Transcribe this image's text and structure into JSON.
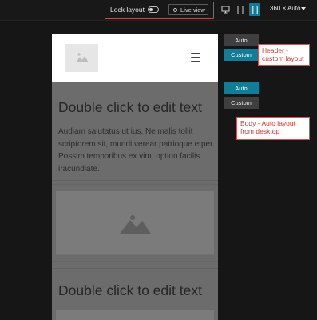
{
  "toolbar": {
    "lock_layout_label": "Lock layout",
    "lock_layout_on": false,
    "live_view_label": "Live view",
    "device_selected": "mobile",
    "size_label": "360 × Auto"
  },
  "header_layout": {
    "auto_label": "Auto",
    "custom_label": "Custom",
    "selected": "Custom"
  },
  "body_layout": {
    "auto_label": "Auto",
    "custom_label": "Custom",
    "selected": "Auto"
  },
  "page": {
    "heading1": "Double click to edit text",
    "paragraph": "Audiam salutatus ut ius. Ne malis tollit scriptorem sit, mundi verear patrioque etper. Possim temporibus ex vim, option facilis iracundiate.",
    "heading2": "Double click to edit text"
  },
  "annotations": {
    "header_note": "Header - custom layout",
    "body_note": "Body - Auto layout from desktop"
  },
  "colors": {
    "accent_teal": "#117d96",
    "highlight_red": "#e0413b",
    "background": "#161616"
  },
  "icons": [
    "toggle-switch",
    "live-view-dot",
    "desktop-icon",
    "tablet-icon",
    "mobile-icon",
    "image-placeholder-icon",
    "hamburger-menu-icon",
    "chevron-down-icon"
  ]
}
